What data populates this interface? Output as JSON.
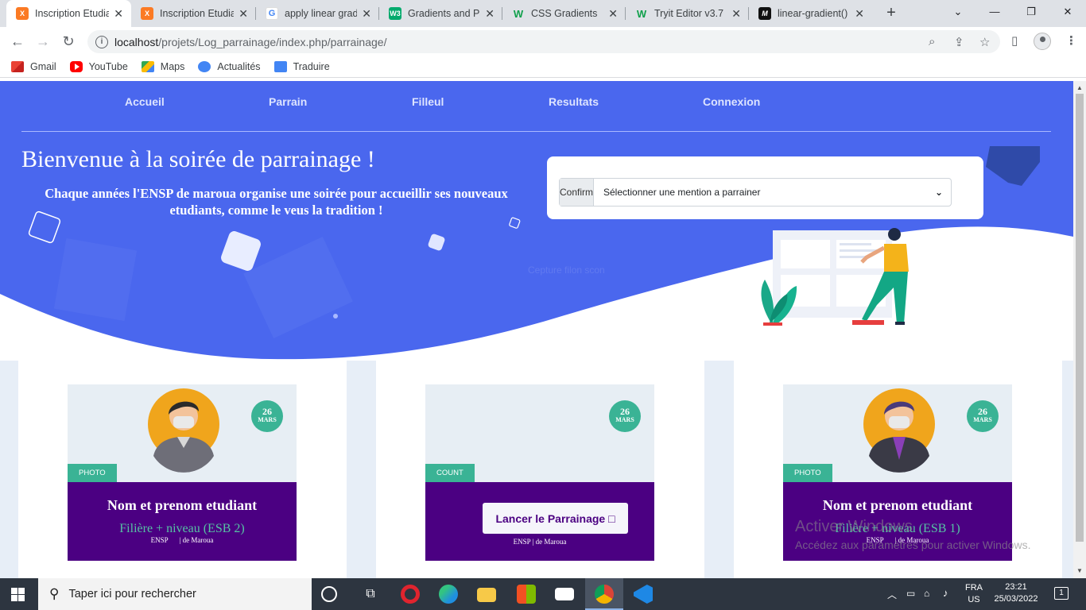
{
  "browser": {
    "tabs": [
      {
        "title": "Inscription Etudia",
        "icon": "xampp-icon",
        "active": true
      },
      {
        "title": "Inscription Etudia",
        "icon": "xampp-icon",
        "active": false
      },
      {
        "title": "apply linear gradi",
        "icon": "google-icon",
        "active": false
      },
      {
        "title": "Gradients and Pa",
        "icon": "w3schools-icon",
        "active": false
      },
      {
        "title": "CSS Gradients",
        "icon": "w3schools-green-icon",
        "active": false
      },
      {
        "title": "Tryit Editor v3.7",
        "icon": "w3schools-green-icon",
        "active": false
      },
      {
        "title": "linear-gradient()",
        "icon": "mdn-icon",
        "active": false
      }
    ],
    "url_host": "localhost",
    "url_path": "/projets/Log_parrainage/index.php/parrainage/",
    "bookmarks": [
      {
        "label": "Gmail",
        "icon": "gmail-icon"
      },
      {
        "label": "YouTube",
        "icon": "youtube-icon"
      },
      {
        "label": "Maps",
        "icon": "maps-icon"
      },
      {
        "label": "Actualités",
        "icon": "news-icon"
      },
      {
        "label": "Traduire",
        "icon": "translate-icon"
      }
    ]
  },
  "nav": {
    "items": [
      "Accueil",
      "Parrain",
      "Filleul",
      "Resultats",
      "Connexion"
    ]
  },
  "hero": {
    "title": "Bienvenue à la soirée de parrainage !",
    "text": "Chaque années l'ENSP de maroua organise une soirée pour accueillir ses nouveaux etudiants, comme le veus la tradition !",
    "confirm_label": "Confirm",
    "select_value": "Sélectionner une mention a parrainer",
    "ghost_text": "Cepture filon scon"
  },
  "cards": [
    {
      "day": "26",
      "month": "MARS",
      "tag": "PHOTO",
      "name": "Nom et prenom etudiant",
      "sub": "Filière + niveau (ESB 2)",
      "school": "ENSP",
      "city": "| de Maroua"
    },
    {
      "day": "26",
      "month": "MARS",
      "tag": "COUNT",
      "button": "Lancer le Parrainage □",
      "footer": "ENSP | de Maroua"
    },
    {
      "day": "26",
      "month": "MARS",
      "tag": "PHOTO",
      "name": "Nom et prenom etudiant",
      "sub": "Filière + niveau (ESB 1)",
      "school": "ENSP",
      "city": "| de Maroua"
    }
  ],
  "watermark": {
    "line1": "Activer Windows",
    "line2": "Accédez aux paramètres pour activer Windows."
  },
  "taskbar": {
    "search_placeholder": "Taper ici pour rechercher",
    "lang1": "FRA",
    "lang2": "US",
    "time": "23:21",
    "date": "25/03/2022",
    "notification_count": "1"
  },
  "colors": {
    "hero_blue": "#4a67ee",
    "card_purple": "#4b0082",
    "accent_green": "#3ab395"
  }
}
